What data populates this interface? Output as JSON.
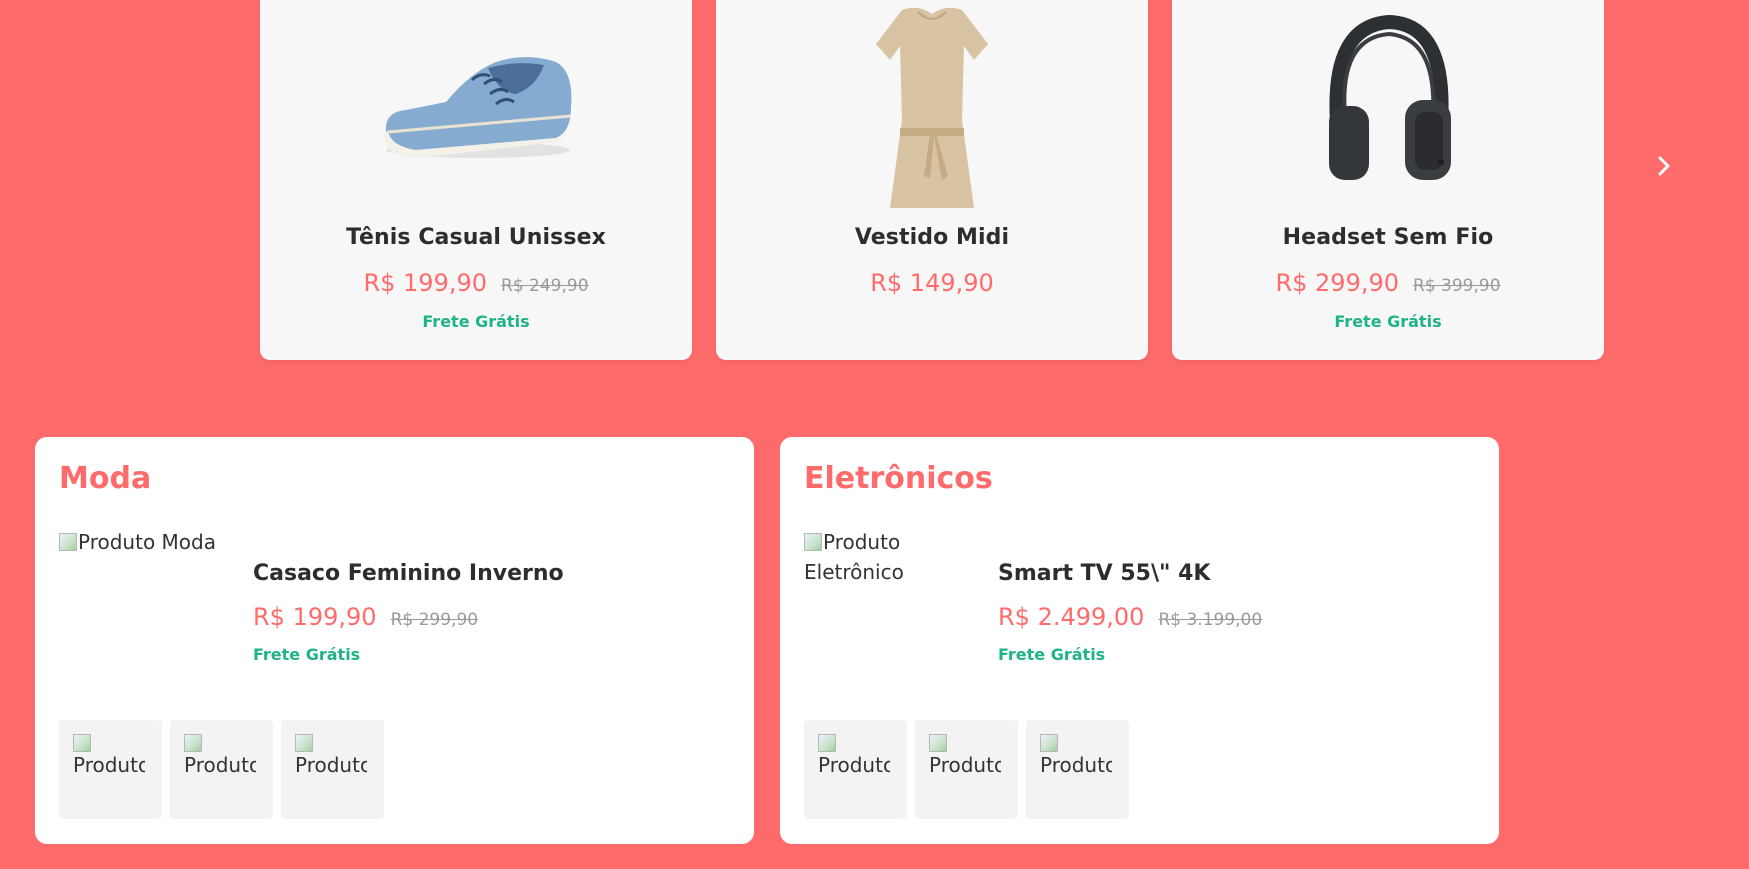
{
  "carousel": {
    "products": [
      {
        "name": "Tênis Casual Unissex",
        "price": "R$ 199,90",
        "old_price": "R$ 249,90",
        "shipping": "Frete Grátis",
        "image_icon": "sneaker-icon"
      },
      {
        "name": "Vestido Midi",
        "price": "R$ 149,90",
        "old_price": "",
        "shipping": "",
        "image_icon": "dress-icon"
      },
      {
        "name": "Headset Sem Fio",
        "price": "R$ 299,90",
        "old_price": "R$ 399,90",
        "shipping": "Frete Grátis",
        "image_icon": "headphones-icon"
      }
    ],
    "next_icon": "chevron-right-icon"
  },
  "categories": [
    {
      "title": "Moda",
      "featured": {
        "image_alt": "Produto Moda",
        "name": "Casaco Feminino Inverno",
        "price": "R$ 199,90",
        "old_price": "R$ 299,90",
        "shipping": "Frete Grátis"
      },
      "thumbnails": [
        "Produto",
        "Produto",
        "Produto"
      ]
    },
    {
      "title": "Eletrônicos",
      "featured": {
        "image_alt": "Produto Eletrônico",
        "name": "Smart TV 55\\\" 4K",
        "price": "R$ 2.499,00",
        "old_price": "R$ 3.199,00",
        "shipping": "Frete Grátis"
      },
      "thumbnails": [
        "Produto",
        "Produto",
        "Produto"
      ]
    }
  ],
  "colors": {
    "background": "#ff6b6b",
    "price": "#ff6b6b",
    "shipping": "#1fb386",
    "card": "#f7f7f7"
  }
}
